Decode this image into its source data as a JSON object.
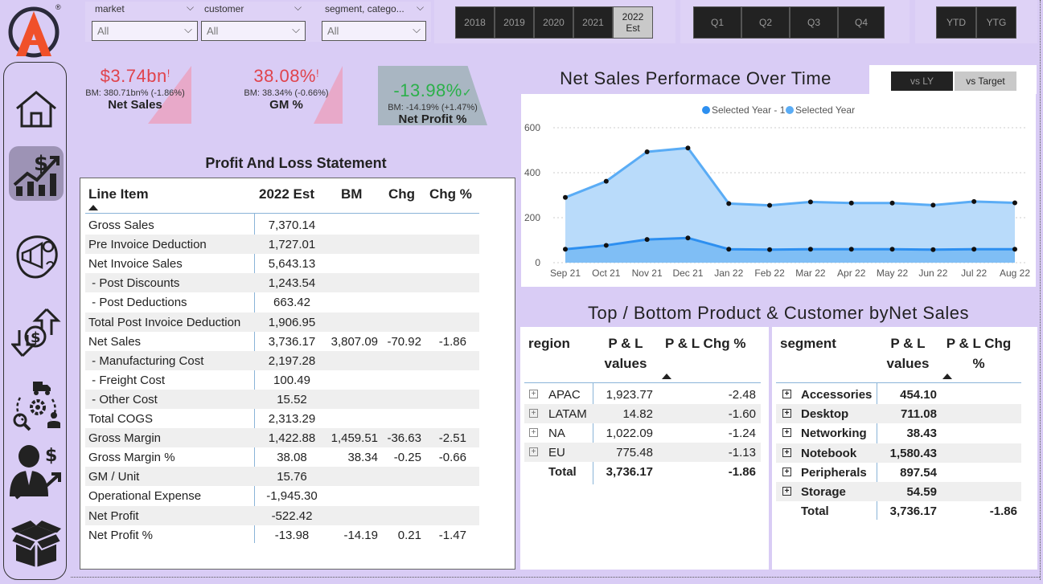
{
  "filters": {
    "market": {
      "label": "market",
      "value": "All"
    },
    "customer": {
      "label": "customer",
      "value": "All"
    },
    "segment": {
      "label": "segment, catego...",
      "value": "All"
    }
  },
  "years": [
    "2018",
    "2019",
    "2020",
    "2021"
  ],
  "year_selected": {
    "line1": "2022",
    "line2": "Est"
  },
  "quarters": [
    "Q1",
    "Q2",
    "Q3",
    "Q4"
  ],
  "period": [
    "YTD",
    "YTG"
  ],
  "logo_mark": "®",
  "kpis": [
    {
      "value": "$3.74bn",
      "flag": "!",
      "bm": "BM: 380.71bn% (-1.86%)",
      "name": "Net Sales",
      "color": "#e0434c"
    },
    {
      "value": "38.08%",
      "flag": "!",
      "bm": "BM: 38.34% (-0.66%)",
      "name": "GM %",
      "color": "#e0434c"
    },
    {
      "value": "-13.98%",
      "flag": "✓",
      "bm": "BM: -14.19% (+1.47%)",
      "name": "Net Profit %",
      "color": "#2bb04a"
    }
  ],
  "pl": {
    "title": "Profit And Loss Statement",
    "headers": [
      "Line Item",
      "2022 Est",
      "BM",
      "Chg",
      "Chg %"
    ],
    "rows": [
      {
        "item": "Gross Sales",
        "est": "7,370.14",
        "bm": "",
        "chg": "",
        "pct": ""
      },
      {
        "item": "Pre Invoice Deduction",
        "est": "1,727.01",
        "bm": "",
        "chg": "",
        "pct": ""
      },
      {
        "item": "Net Invoice Sales",
        "est": "5,643.13",
        "bm": "",
        "chg": "",
        "pct": ""
      },
      {
        "item": " - Post Discounts",
        "est": "1,243.54",
        "bm": "",
        "chg": "",
        "pct": ""
      },
      {
        "item": " - Post Deductions",
        "est": "663.42",
        "bm": "",
        "chg": "",
        "pct": ""
      },
      {
        "item": "Total Post Invoice Deduction",
        "est": "1,906.95",
        "bm": "",
        "chg": "",
        "pct": ""
      },
      {
        "item": "Net Sales",
        "est": "3,736.17",
        "bm": "3,807.09",
        "chg": "-70.92",
        "pct": "-1.86"
      },
      {
        "item": " - Manufacturing Cost",
        "est": "2,197.28",
        "bm": "",
        "chg": "",
        "pct": ""
      },
      {
        "item": " - Freight Cost",
        "est": "100.49",
        "bm": "",
        "chg": "",
        "pct": ""
      },
      {
        "item": " - Other Cost",
        "est": "15.52",
        "bm": "",
        "chg": "",
        "pct": ""
      },
      {
        "item": "Total COGS",
        "est": "2,313.29",
        "bm": "",
        "chg": "",
        "pct": ""
      },
      {
        "item": "Gross Margin",
        "est": "1,422.88",
        "bm": "1,459.51",
        "chg": "-36.63",
        "pct": "-2.51"
      },
      {
        "item": "Gross Margin %",
        "est": "38.08",
        "bm": "38.34",
        "chg": "-0.25",
        "pct": "-0.66"
      },
      {
        "item": "GM / Unit",
        "est": "15.76",
        "bm": "",
        "chg": "",
        "pct": ""
      },
      {
        "item": "Operational Expense",
        "est": "-1,945.30",
        "bm": "",
        "chg": "",
        "pct": ""
      },
      {
        "item": "Net Profit",
        "est": "-522.42",
        "bm": "",
        "chg": "",
        "pct": ""
      },
      {
        "item": "Net Profit %",
        "est": "-13.98",
        "bm": "-14.19",
        "chg": "0.21",
        "pct": "-1.47"
      }
    ]
  },
  "chart": {
    "title": "Net Sales Performace Over Time",
    "vs_buttons": [
      "vs LY",
      "vs Target"
    ]
  },
  "chart_data": {
    "type": "area",
    "categories": [
      "Sep 21",
      "Oct 21",
      "Nov 21",
      "Dec 21",
      "Jan 22",
      "Feb 22",
      "Mar 22",
      "Apr 22",
      "May 22",
      "Jun 22",
      "Jul 22",
      "Aug 22"
    ],
    "series": [
      {
        "name": "Selected Year - 1",
        "values": [
          60,
          77,
          103,
          110,
          60,
          58,
          60,
          60,
          60,
          58,
          60,
          60
        ],
        "color": "#2d8ff0"
      },
      {
        "name": "Selected Year",
        "values": [
          290,
          362,
          493,
          510,
          263,
          255,
          270,
          265,
          265,
          256,
          272,
          266
        ],
        "color": "#5aacf5"
      }
    ],
    "yticks": [
      "0",
      "200",
      "400",
      "600"
    ],
    "ylim": [
      0,
      600
    ],
    "grid": true,
    "legend": "top-center"
  },
  "tb": {
    "title": "Top / Bottom Product & Customer byNet Sales",
    "region": {
      "headers": [
        "region",
        "P & L values",
        "P & L Chg %"
      ],
      "rows": [
        {
          "name": "APAC",
          "value": "1,923.77",
          "chg": "-2.48"
        },
        {
          "name": "LATAM",
          "value": "14.82",
          "chg": "-1.60"
        },
        {
          "name": "NA",
          "value": "1,022.09",
          "chg": "-1.24"
        },
        {
          "name": "EU",
          "value": "775.48",
          "chg": "-1.13"
        }
      ],
      "total": {
        "name": "Total",
        "value": "3,736.17",
        "chg": "-1.86"
      }
    },
    "segment": {
      "headers": [
        "segment",
        "P & L values",
        "P & L Chg %"
      ],
      "rows": [
        {
          "name": "Accessories",
          "value": "454.10",
          "chg": ""
        },
        {
          "name": "Desktop",
          "value": "711.08",
          "chg": ""
        },
        {
          "name": "Networking",
          "value": "38.43",
          "chg": ""
        },
        {
          "name": "Notebook",
          "value": "1,580.43",
          "chg": ""
        },
        {
          "name": "Peripherals",
          "value": "897.54",
          "chg": ""
        },
        {
          "name": "Storage",
          "value": "54.59",
          "chg": ""
        }
      ],
      "total": {
        "name": "Total",
        "value": "3,736.17",
        "chg": "-1.86"
      }
    }
  },
  "nav": [
    "home-icon",
    "finance-view-icon",
    "marketing-view-icon",
    "finance-exchange-icon",
    "supply-chain-icon",
    "executive-view-icon",
    "product-box-icon"
  ]
}
